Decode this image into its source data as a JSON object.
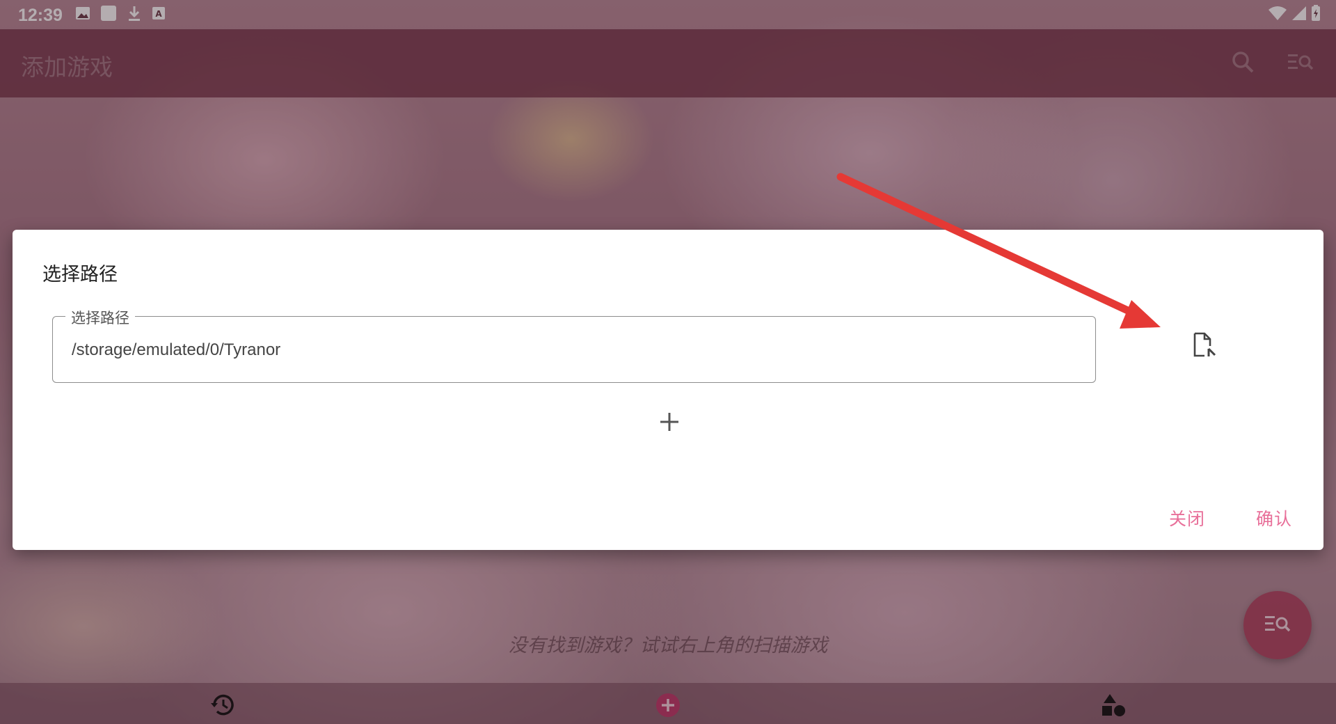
{
  "status_bar": {
    "time": "12:39",
    "left_icons": [
      "image-icon",
      "square-icon",
      "download-icon",
      "keyboard-a-icon"
    ],
    "right_icons": [
      "wifi-icon",
      "signal-icon",
      "battery-charging-icon"
    ]
  },
  "toolbar": {
    "title": "添加游戏",
    "actions": [
      "search-icon",
      "scan-list-icon"
    ]
  },
  "dialog": {
    "title": "选择路径",
    "path_field": {
      "label": "选择路径",
      "value": "/storage/emulated/0/Tyranor"
    },
    "file_picker_icon": "file-open-icon",
    "add_icon": "plus-icon",
    "close_label": "关闭",
    "confirm_label": "确认"
  },
  "empty_state": {
    "hint": "没有找到游戏？试试右上角的扫描游戏"
  },
  "fab": {
    "icon": "scan-list-icon"
  },
  "bottom_nav": {
    "items": [
      "history-icon",
      "add-circle-icon",
      "shapes-icon"
    ]
  },
  "colors": {
    "accent": "#e86f99",
    "toolbar": "#763448",
    "annotation_arrow": "#e53935"
  }
}
